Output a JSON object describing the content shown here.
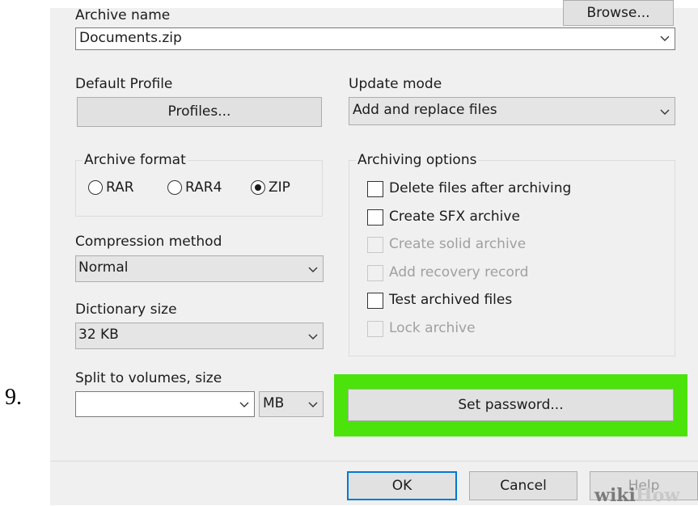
{
  "step_number": "9.",
  "archive_name": {
    "label": "Archive name",
    "browse_label": "Browse...",
    "value": "Documents.zip"
  },
  "default_profile": {
    "label": "Default Profile",
    "profiles_button": "Profiles..."
  },
  "update_mode": {
    "label": "Update mode",
    "value": "Add and replace files"
  },
  "archive_format": {
    "title": "Archive format",
    "options": [
      {
        "label": "RAR",
        "selected": false
      },
      {
        "label": "RAR4",
        "selected": false
      },
      {
        "label": "ZIP",
        "selected": true
      }
    ]
  },
  "archiving_options": {
    "title": "Archiving options",
    "items": [
      {
        "label": "Delete files after archiving",
        "checked": false,
        "enabled": true
      },
      {
        "label": "Create SFX archive",
        "checked": false,
        "enabled": true
      },
      {
        "label": "Create solid archive",
        "checked": false,
        "enabled": false
      },
      {
        "label": "Add recovery record",
        "checked": false,
        "enabled": false
      },
      {
        "label": "Test archived files",
        "checked": false,
        "enabled": true
      },
      {
        "label": "Lock archive",
        "checked": false,
        "enabled": false
      }
    ]
  },
  "compression_method": {
    "label": "Compression method",
    "value": "Normal"
  },
  "dictionary_size": {
    "label": "Dictionary size",
    "value": "32 KB"
  },
  "split_volumes": {
    "label": "Split to volumes, size",
    "value": "",
    "unit": "MB"
  },
  "set_password_button": "Set password...",
  "footer": {
    "ok": "OK",
    "cancel": "Cancel",
    "help": "Help"
  },
  "watermark": {
    "wiki": "wiki",
    "how": "How"
  },
  "colors": {
    "highlight": "#4be30b",
    "dialog_bg": "#f0f0f0",
    "default_button_border": "#0078d7"
  }
}
